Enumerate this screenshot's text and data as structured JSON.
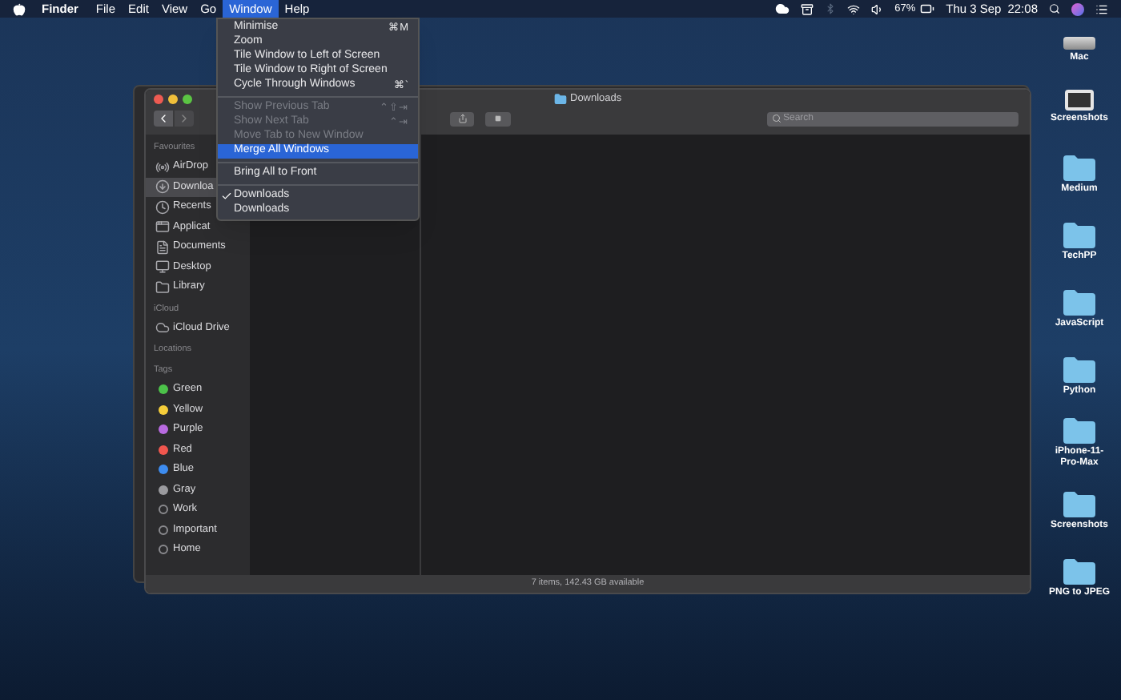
{
  "menu_bar": {
    "app": "Finder",
    "menus": [
      {
        "label": "File",
        "selected": false
      },
      {
        "label": "Edit",
        "selected": false
      },
      {
        "label": "View",
        "selected": false
      },
      {
        "label": "Go",
        "selected": false
      },
      {
        "label": "Window",
        "selected": true
      },
      {
        "label": "Help",
        "selected": false
      }
    ],
    "battery": "67%",
    "date": "Thu 3 Sep",
    "time": "22:08"
  },
  "window_menu": {
    "items": [
      {
        "kind": "item",
        "label": "Minimise",
        "shortcut": "⌘M",
        "disabled": false,
        "selected": false,
        "checked": false
      },
      {
        "kind": "item",
        "label": "Zoom",
        "disabled": false,
        "selected": false,
        "checked": false
      },
      {
        "kind": "item",
        "label": "Tile Window to Left of Screen",
        "disabled": false,
        "selected": false,
        "checked": false
      },
      {
        "kind": "item",
        "label": "Tile Window to Right of Screen",
        "disabled": false,
        "selected": false,
        "checked": false
      },
      {
        "kind": "item",
        "label": "Cycle Through Windows",
        "shortcut": "⌘`",
        "disabled": false,
        "selected": false,
        "checked": false
      },
      {
        "kind": "separator"
      },
      {
        "kind": "item",
        "label": "Show Previous Tab",
        "shortcut": "⌃⇧⇥",
        "disabled": true,
        "selected": false,
        "checked": false
      },
      {
        "kind": "item",
        "label": "Show Next Tab",
        "shortcut": "⌃⇥",
        "disabled": true,
        "selected": false,
        "checked": false
      },
      {
        "kind": "item",
        "label": "Move Tab to New Window",
        "disabled": true,
        "selected": false,
        "checked": false
      },
      {
        "kind": "item",
        "label": "Merge All Windows",
        "disabled": false,
        "selected": true,
        "checked": false
      },
      {
        "kind": "separator"
      },
      {
        "kind": "item",
        "label": "Bring All to Front",
        "disabled": false,
        "selected": false,
        "checked": false
      },
      {
        "kind": "separator"
      },
      {
        "kind": "item",
        "label": "Downloads",
        "disabled": false,
        "selected": false,
        "checked": true
      },
      {
        "kind": "item",
        "label": "Downloads",
        "disabled": false,
        "selected": false,
        "checked": false
      }
    ]
  },
  "finder": {
    "title": "Downloads",
    "search": {
      "placeholder": "Search"
    },
    "sidebar": [
      {
        "heading": "Favourites",
        "items": [
          {
            "kind": "airdrop",
            "label": "AirDrop",
            "selected": false
          },
          {
            "kind": "downloads",
            "label": "Downloa",
            "selected": true
          },
          {
            "kind": "recents",
            "label": "Recents",
            "selected": false
          },
          {
            "kind": "applications",
            "label": "Applicat",
            "selected": false
          },
          {
            "kind": "documents",
            "label": "Documents",
            "selected": false
          },
          {
            "kind": "desktop",
            "label": "Desktop",
            "selected": false
          },
          {
            "kind": "library",
            "label": "Library",
            "selected": false
          }
        ]
      },
      {
        "heading": "iCloud",
        "items": [
          {
            "kind": "cloud",
            "label": "iCloud Drive",
            "selected": false
          }
        ]
      },
      {
        "heading": "Locations"
      },
      {
        "heading": "Tags",
        "items": [
          {
            "kind": "tag",
            "label": "Green",
            "color": "#4cc24a",
            "selected": false
          },
          {
            "kind": "tag",
            "label": "Yellow",
            "color": "#f5cd3a",
            "selected": false
          },
          {
            "kind": "tag",
            "label": "Purple",
            "color": "#b86ae0",
            "selected": false
          },
          {
            "kind": "tag",
            "label": "Red",
            "color": "#f0564e",
            "selected": false
          },
          {
            "kind": "tag",
            "label": "Blue",
            "color": "#3d8cf0",
            "selected": false
          },
          {
            "kind": "tag",
            "label": "Gray",
            "color": "#9a9a9e",
            "selected": false
          },
          {
            "kind": "tag-empty",
            "label": "Work",
            "selected": false
          },
          {
            "kind": "tag-empty",
            "label": "Important",
            "selected": false
          },
          {
            "kind": "tag-empty",
            "label": "Home",
            "selected": false
          }
        ]
      }
    ],
    "status_bar": "7 items, 142.43 GB available"
  },
  "desktop_icons": [
    {
      "kind": "drive",
      "label": "Mac"
    },
    {
      "kind": "screenshot",
      "label": "Screenshots"
    },
    {
      "kind": "folder",
      "label": "Medium"
    },
    {
      "kind": "folder",
      "label": "TechPP"
    },
    {
      "kind": "folder",
      "label": "JavaScript"
    },
    {
      "kind": "folder",
      "label": "Python"
    },
    {
      "kind": "folder",
      "label": "iPhone-11-Pro-Max"
    },
    {
      "kind": "folder",
      "label": "Screenshots"
    },
    {
      "kind": "folder",
      "label": "PNG to JPEG"
    }
  ]
}
